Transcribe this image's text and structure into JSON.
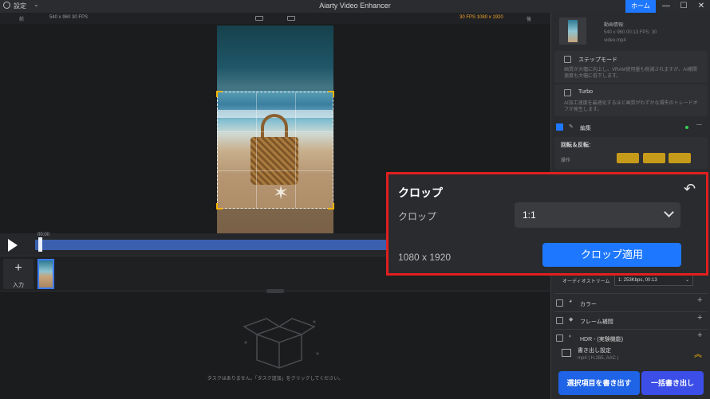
{
  "titlebar": {
    "settings_label": "設定",
    "app_title": "Aiarty Video Enhancer",
    "home_label": "ホーム",
    "minimize": "—",
    "maximize": "☐",
    "close": "✕"
  },
  "preview_header": {
    "prev_label": "前",
    "source_info": "540 x 960  30 FPS",
    "output_info": "30 FPS  1080 x 1920",
    "next_label": "後"
  },
  "timeline": {
    "time": "00:00",
    "progress_fraction": 0.01
  },
  "tasks": {
    "add_label": "入力"
  },
  "empty_state": {
    "message": "タスクはありません。「タスク追加」をクリックしてください。"
  },
  "sidebar": {
    "file_info_title": "動画情報:",
    "file_info_meta": "540 x 960   00:13   FPS: 30",
    "file_name": "video.mp4",
    "step_mode_label": "ステップモード",
    "step_mode_desc": "画質が大幅に向上し、VRAM使用量も削減されますが、AI補間速度も大幅に低下します。",
    "turbo_label": "Turbo",
    "turbo_desc": "AI加工速度を最適化するほど画質がわずかな損失のトレードオフが発生します。",
    "edit_label": "編集",
    "rotate_label": "回転＆反転:",
    "operation_label": "操作",
    "audio_stream_label": "オーディオストリーム",
    "audio_stream_value": "1: 253Kbps, 00:13",
    "color_label": "カラー",
    "frame_interp_label": "フレーム補間",
    "hdr_label": "HDR - (実験機能)",
    "export_settings_label": "書き出し設定",
    "export_format": "mp4 | H.265, AAC |",
    "export_selected_label": "選択項目を書き出す",
    "export_all_label": "一括書き出し"
  },
  "crop_popup": {
    "title": "クロップ",
    "crop_label": "クロップ",
    "ratio_value": "1:1",
    "resolution": "1080 x 1920",
    "apply_label": "クロップ適用",
    "border_color": "#e11f1f",
    "accent_color": "#1e78ff"
  }
}
